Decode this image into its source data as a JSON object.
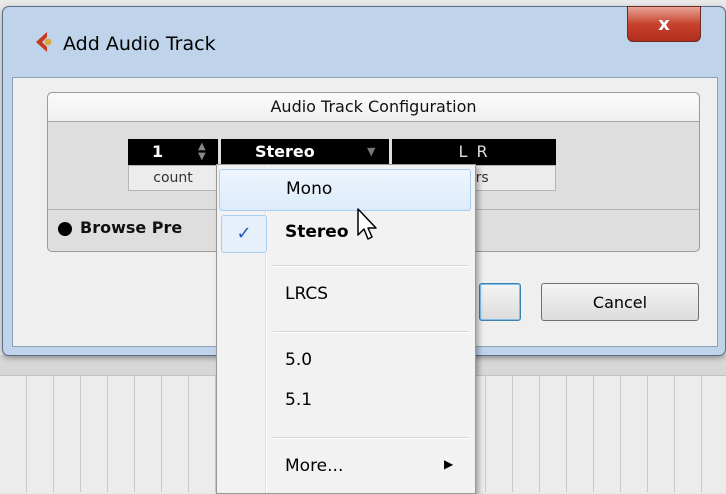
{
  "window": {
    "title": "Add Audio Track",
    "close_label": "x"
  },
  "config": {
    "header": "Audio Track Configuration",
    "count_value": "1",
    "count_label": "count",
    "config_value": "Stereo",
    "speakers_value": "L R",
    "speakers_label": "speakers",
    "speakers_label_visible": "kers",
    "browse_presets_label": "Browse Pre"
  },
  "buttons": {
    "ok_label": "",
    "cancel_label": "Cancel"
  },
  "menu": {
    "items": [
      {
        "label": "Mono",
        "highlighted": true
      },
      {
        "label": "Stereo",
        "checked": true
      },
      {
        "label": "LRCS"
      },
      {
        "label": "5.0"
      },
      {
        "label": "5.1"
      },
      {
        "label": "More...",
        "submenu": true
      }
    ],
    "check_glyph": "✓",
    "submenu_glyph": "▶"
  },
  "icons": {
    "app": "cubase-icon",
    "close": "close-icon",
    "spinner": "spinner-arrows-icon",
    "dropdown": "dropdown-arrow-icon",
    "checkmark": "checkmark-icon",
    "cursor": "mouse-pointer-icon"
  },
  "colors": {
    "accent": "#215db4",
    "close_red": "#c7422f",
    "title_bar": "#bfd4ea"
  }
}
